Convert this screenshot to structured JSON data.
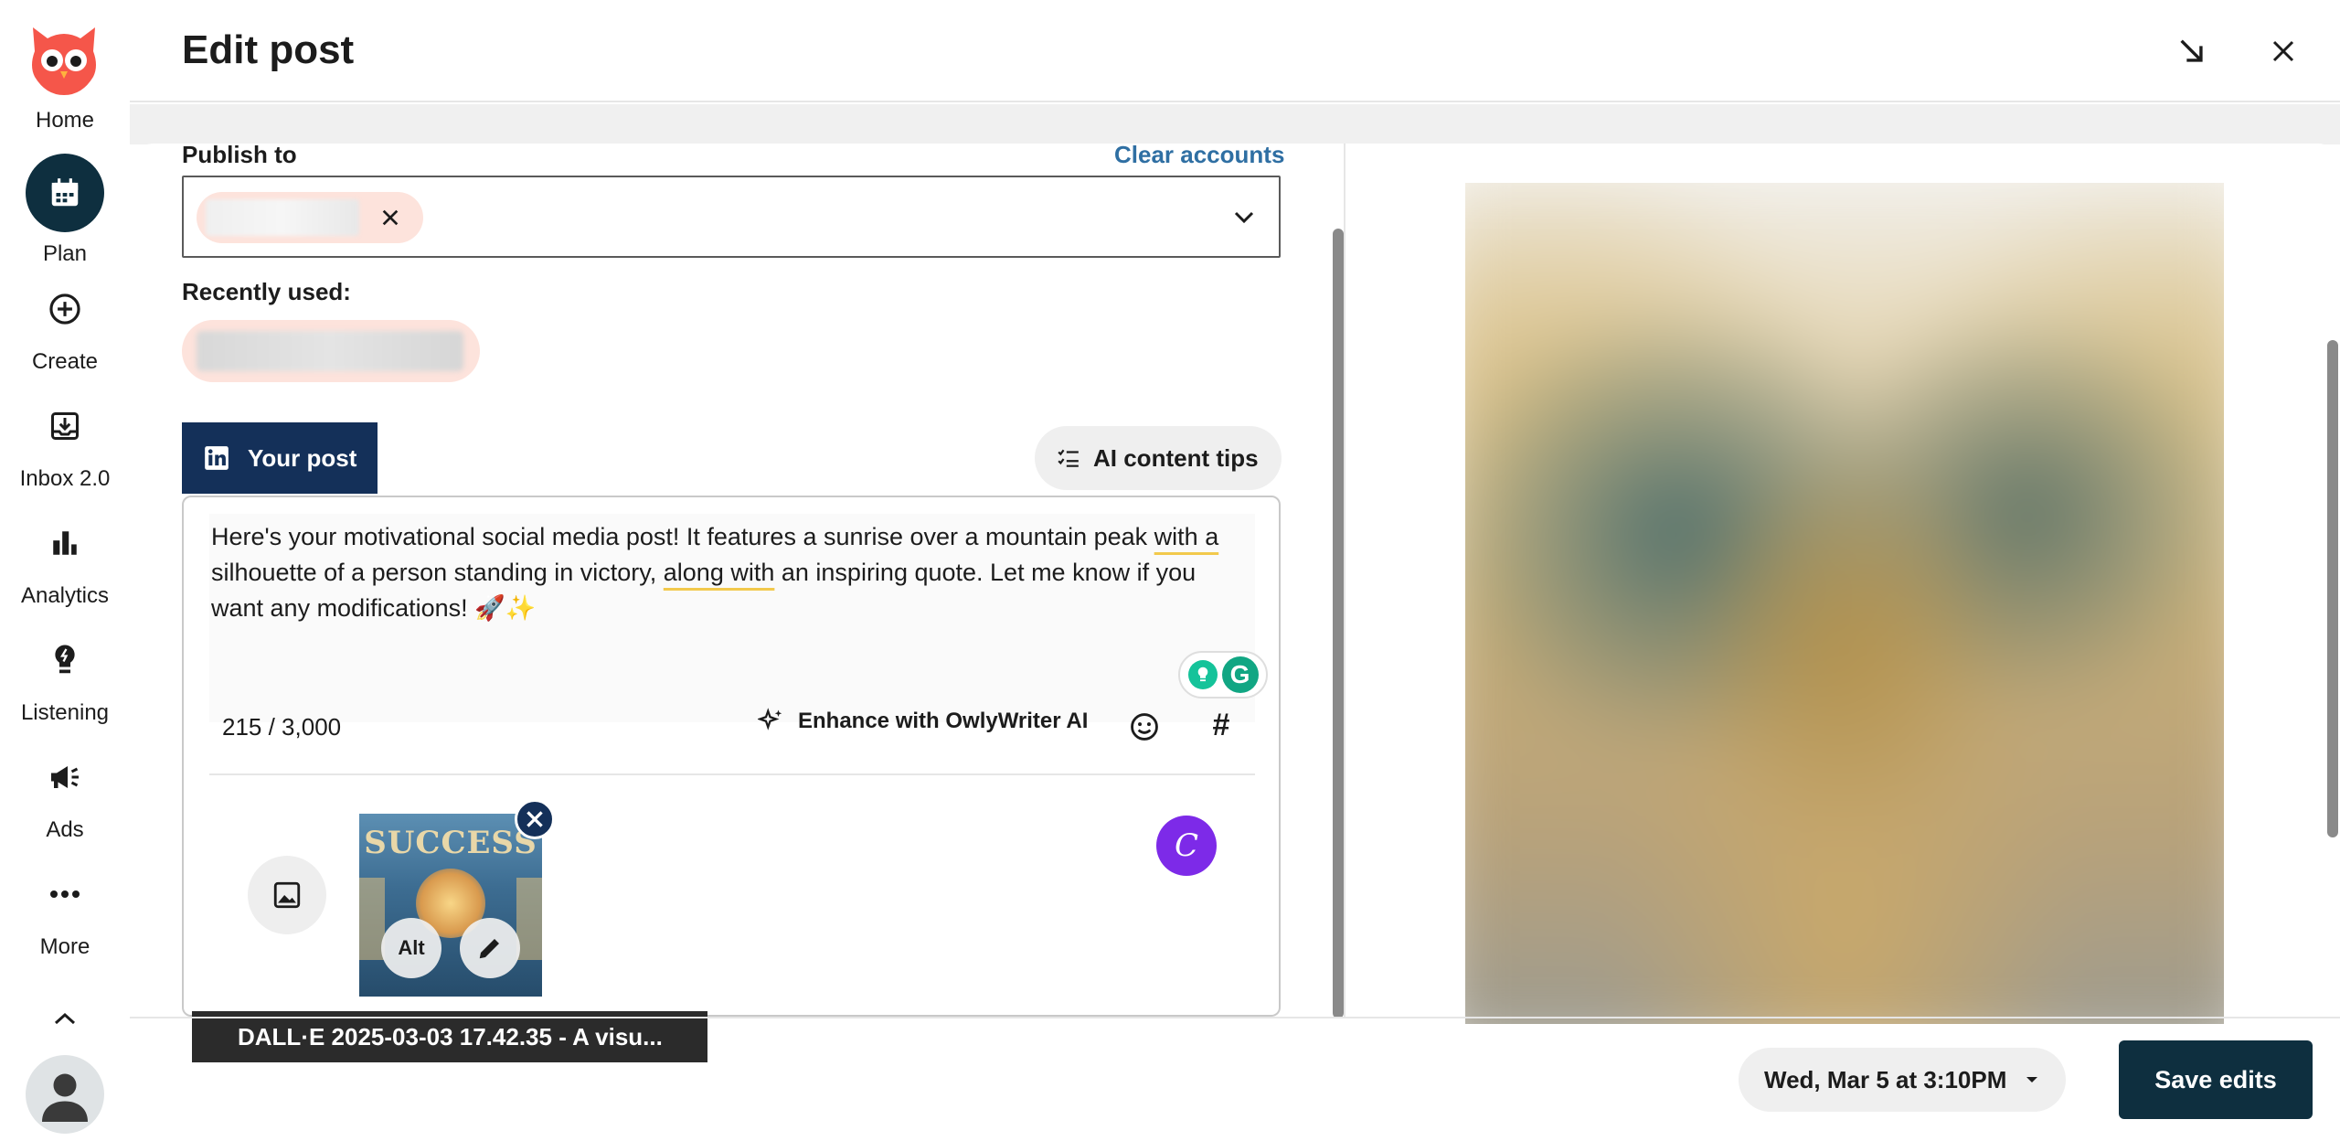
{
  "header": {
    "title": "Edit post"
  },
  "sidebar": {
    "items": [
      {
        "label": "Home",
        "icon": "owl-logo-icon"
      },
      {
        "label": "Plan",
        "icon": "calendar-icon",
        "active": true
      },
      {
        "label": "Create",
        "icon": "plus-circle-icon"
      },
      {
        "label": "Inbox 2.0",
        "icon": "inbox-icon"
      },
      {
        "label": "Analytics",
        "icon": "bar-chart-icon"
      },
      {
        "label": "Listening",
        "icon": "lightbulb-icon"
      },
      {
        "label": "Ads",
        "icon": "megaphone-icon"
      },
      {
        "label": "More",
        "icon": "ellipsis-icon"
      }
    ]
  },
  "publish": {
    "label": "Publish to",
    "clear_label": "Clear accounts",
    "recent_label": "Recently used:"
  },
  "composer": {
    "tab_label": "Your post",
    "ai_tips_label": "AI content tips",
    "text_part1": "Here's your motivational social media post! It features a sunrise over a mountain peak ",
    "text_u1": "with a",
    "text_part2": " silhouette of a person standing in victory, ",
    "text_u2": "along with",
    "text_part3": " an inspiring quote. Let me know if you want any modifications! 🚀✨",
    "char_count": "215 / 3,000",
    "enhance_label": "Enhance with OwlyWriter AI",
    "hashtag_symbol": "#",
    "media": {
      "thumb_title": "SUCCESS",
      "alt_label": "Alt",
      "filename_tooltip": "DALL·E 2025-03-03 17.42.35 - A visu..."
    },
    "canva_letter": "C"
  },
  "footer": {
    "schedule_label": "Wed, Mar 5 at 3:10PM",
    "save_label": "Save edits"
  },
  "colors": {
    "brand_dark": "#0e2f3f",
    "linkedin_tab": "#143059",
    "link_blue": "#2f6fa3",
    "chip_pink": "#fde3dc",
    "canva_purple": "#7d2ae8",
    "owl_red": "#f5564a"
  }
}
